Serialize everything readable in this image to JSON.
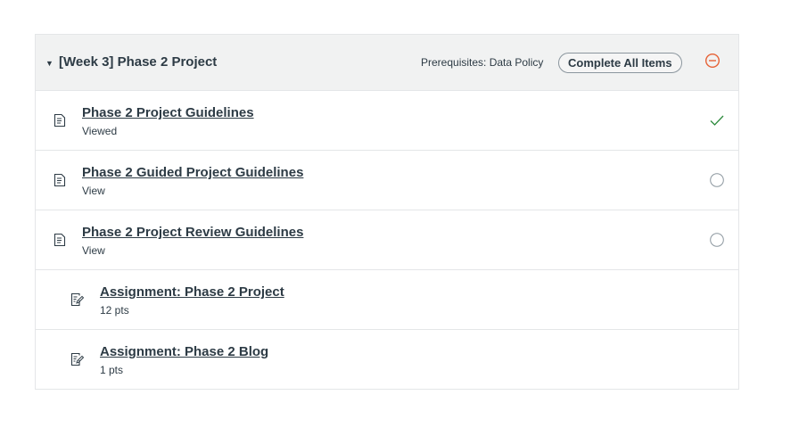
{
  "module": {
    "title": "[Week 3] Phase 2 Project",
    "prerequisites": "Prerequisites: Data Policy",
    "complete_all_label": "Complete All Items",
    "accent_color": "#e66135",
    "items": [
      {
        "title": "Phase 2 Project Guidelines",
        "sub": "Viewed",
        "type": "page",
        "status": "completed"
      },
      {
        "title": "Phase 2 Guided Project Guidelines",
        "sub": "View",
        "type": "page",
        "status": "incomplete"
      },
      {
        "title": "Phase 2 Project Review Guidelines",
        "sub": "View",
        "type": "page",
        "status": "incomplete"
      },
      {
        "title": "Assignment: Phase 2 Project",
        "sub": "12 pts",
        "type": "assignment",
        "status": "none"
      },
      {
        "title": "Assignment: Phase 2 Blog",
        "sub": "1 pts",
        "type": "assignment",
        "status": "none"
      }
    ]
  }
}
